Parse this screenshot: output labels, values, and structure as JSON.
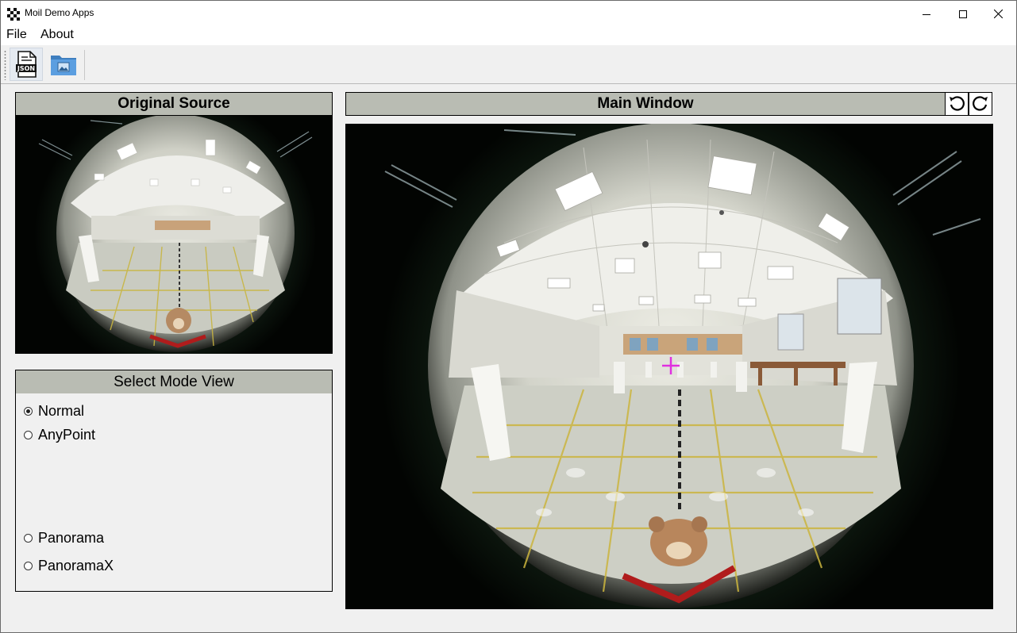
{
  "window": {
    "title": "Moil Demo Apps",
    "controls": [
      "minimize-icon",
      "maximize-icon",
      "close-icon"
    ]
  },
  "menu": {
    "file": "File",
    "about": "About"
  },
  "toolbar": {
    "buttons": [
      {
        "name": "load-json-button",
        "icon": "json-file-icon",
        "icon_text": "JSON"
      },
      {
        "name": "open-image-button",
        "icon": "image-folder-icon"
      }
    ]
  },
  "left_panel": {
    "original_title": "Original Source",
    "mode_title": "Select Mode View",
    "modes": [
      {
        "label": "Normal",
        "selected": true
      },
      {
        "label": "AnyPoint",
        "selected": false
      },
      {
        "label": "Panorama",
        "selected": false
      },
      {
        "label": "PanoramaX",
        "selected": false
      }
    ]
  },
  "main_panel": {
    "title": "Main Window",
    "rotate_left_icon": "rotate-left-icon",
    "rotate_right_icon": "rotate-right-icon",
    "crosshair_color": "#e030e0"
  },
  "colors": {
    "panel_header_bg": "#b9bcb3",
    "window_bg": "#f0f0f0"
  }
}
